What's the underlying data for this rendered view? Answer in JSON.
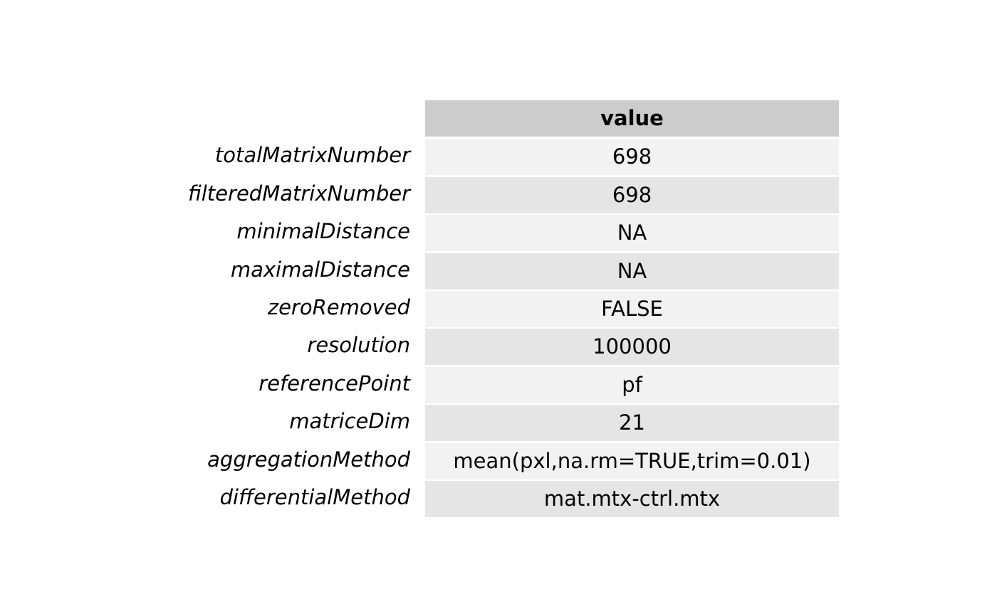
{
  "colors": {
    "header_bg": "#cccccc",
    "row_odd_bg": "#f2f2f2",
    "row_even_bg": "#e5e5e5",
    "divider": "#ffffff",
    "text": "#000000"
  },
  "table": {
    "column_header": "value",
    "rows": [
      {
        "label": "totalMatrixNumber",
        "value": "698"
      },
      {
        "label": "filteredMatrixNumber",
        "value": "698"
      },
      {
        "label": "minimalDistance",
        "value": "NA"
      },
      {
        "label": "maximalDistance",
        "value": "NA"
      },
      {
        "label": "zeroRemoved",
        "value": "FALSE"
      },
      {
        "label": "resolution",
        "value": "100000"
      },
      {
        "label": "referencePoint",
        "value": "pf"
      },
      {
        "label": "matriceDim",
        "value": "21"
      },
      {
        "label": "aggregationMethod",
        "value": "mean(pxl,na.rm=TRUE,trim=0.01)"
      },
      {
        "label": "differentialMethod",
        "value": "mat.mtx-ctrl.mtx"
      }
    ]
  }
}
